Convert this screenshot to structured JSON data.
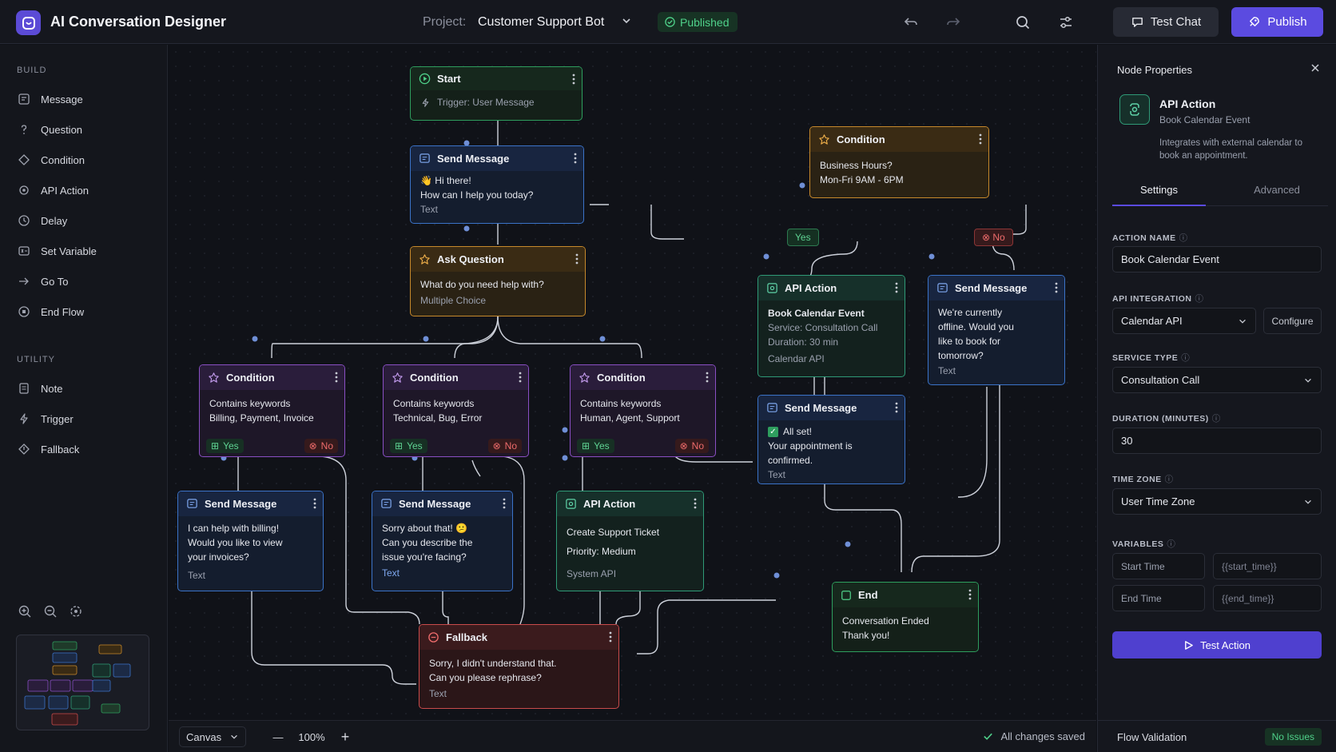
{
  "header": {
    "app_title": "AI Conversation Designer",
    "project_label": "Project:",
    "project_name": "Customer Support Bot",
    "status": "Published",
    "test_chat": "Test Chat",
    "publish": "Publish"
  },
  "sidebar": {
    "build_title": "BUILD",
    "build_items": [
      "Message",
      "Question",
      "Condition",
      "API Action",
      "Delay",
      "Set Variable",
      "Go To",
      "End Flow"
    ],
    "utility_title": "UTILITY",
    "utility_items": [
      "Note",
      "Trigger",
      "Fallback"
    ]
  },
  "nodes": {
    "start": {
      "title": "Start",
      "line1": "Trigger: User Message"
    },
    "greet": {
      "title": "Send Message",
      "line1": "Hi there!",
      "line2": "How can I help you today?",
      "type": "Text"
    },
    "ask": {
      "title": "Ask Question",
      "line1": "What do you need help with?",
      "type": "Multiple Choice"
    },
    "cond1": {
      "title": "Condition",
      "line1": "Contains keywords",
      "line2": "Billing, Payment, Invoice",
      "yes": "Yes",
      "no": "No"
    },
    "cond2": {
      "title": "Condition",
      "line1": "Contains keywords",
      "line2": "Technical, Bug, Error",
      "yes": "Yes",
      "no": "No"
    },
    "cond3": {
      "title": "Condition",
      "line1": "Contains keywords",
      "line2": "Human, Agent, Support",
      "yes": "Yes",
      "no": "No"
    },
    "billing": {
      "title": "Send Message",
      "line1": "I can help with billing!",
      "line2": "Would you like to view",
      "line3": "your invoices?",
      "type": "Text"
    },
    "tech": {
      "title": "Send Message",
      "line1": "Sorry about that! 😕",
      "line2": "Can you describe the",
      "line3": "issue you're facing?",
      "type": "Text"
    },
    "ticket": {
      "title": "API Action",
      "line1": "Create Support Ticket",
      "line2": "Priority: Medium",
      "type": "System API"
    },
    "fallback": {
      "title": "Fallback",
      "line1": "Sorry, I didn't understand that.",
      "line2": "Can you please rephrase?",
      "type": "Text"
    },
    "hours": {
      "title": "Condition",
      "line1": "Business Hours?",
      "line2": "Mon-Fri 9AM - 6PM"
    },
    "book": {
      "title": "API Action",
      "line1": "Book Calendar Event",
      "line2": "Service: Consultation Call",
      "line3": "Duration: 30 min",
      "type": "Calendar API"
    },
    "offline": {
      "title": "Send Message",
      "line1": "We're currently",
      "line2": "offline. Would you",
      "line3": "like to book for",
      "line4": "tomorrow?",
      "type": "Text"
    },
    "confirm": {
      "title": "Send Message",
      "line1": "All set!",
      "line2": "Your appointment is",
      "line3": "confirmed.",
      "type": "Text"
    },
    "end": {
      "title": "End",
      "line1": "Conversation Ended",
      "line2": "Thank you!"
    }
  },
  "edge_labels": {
    "yes": "Yes",
    "no": "No"
  },
  "canvas_bar": {
    "mode": "Canvas",
    "zoom": "100%",
    "saved": "All changes saved"
  },
  "panel": {
    "title": "Node Properties",
    "node_title": "API Action",
    "node_sub": "Book Calendar Event",
    "node_desc": "Integrates with external calendar to book an appointment.",
    "tab_settings": "Settings",
    "tab_advanced": "Advanced",
    "action_name_label": "ACTION NAME",
    "action_name_value": "Book Calendar Event",
    "api_label": "API INTEGRATION",
    "api_value": "Calendar API",
    "configure": "Configure",
    "service_label": "SERVICE TYPE",
    "service_value": "Consultation Call",
    "duration_label": "DURATION (MINUTES)",
    "duration_value": "30",
    "tz_label": "TIME ZONE",
    "tz_value": "User Time Zone",
    "vars_label": "VARIABLES",
    "vars": [
      {
        "k": "Start Time",
        "v": "{{start_time}}"
      },
      {
        "k": "End Time",
        "v": "{{end_time}}"
      }
    ],
    "test_action": "Test Action",
    "fv_label": "Flow Validation",
    "fv_status": "No Issues"
  },
  "colors": {
    "accent": "#5b4be0",
    "green": "#2e9e5e",
    "blue": "#3b73c8",
    "orange": "#c7892b",
    "purple": "#8a4fc4",
    "red": "#c94b4b",
    "teal": "#2f9a77"
  }
}
